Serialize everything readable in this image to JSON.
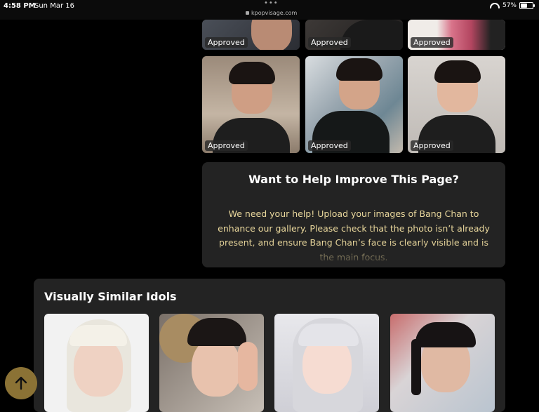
{
  "status_bar": {
    "time": "4:58 PM",
    "date": "Sun Mar 16",
    "url": "kpopvisage.com",
    "battery_percent": "57%",
    "battery_level": 0.57
  },
  "gallery": {
    "badge_label": "Approved",
    "items": [
      {
        "status": "Approved"
      },
      {
        "status": "Approved"
      },
      {
        "status": "Approved"
      },
      {
        "status": "Approved"
      },
      {
        "status": "Approved"
      },
      {
        "status": "Approved"
      }
    ]
  },
  "help_card": {
    "title": "Want to Help Improve This Page?",
    "body": "We need your help! Upload your images of Bang Chan to enhance our gallery. Please check that the photo isn’t already present, and ensure Bang Chan’s face is clearly visible and is the main focus."
  },
  "similar": {
    "title": "Visually Similar Idols"
  },
  "scroll_top": {
    "icon": "arrow-up-icon"
  },
  "colors": {
    "background": "#000000",
    "card": "#232323",
    "help_text": "#e9d79c",
    "scroll_button": "#8b7235"
  }
}
